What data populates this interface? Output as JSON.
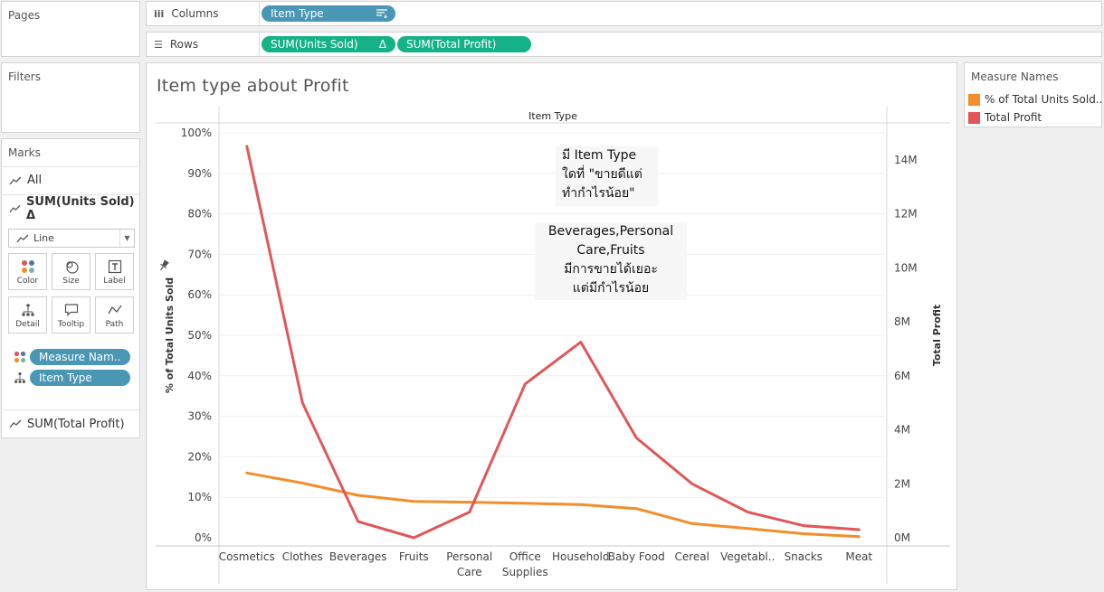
{
  "sidebar": {
    "pages_title": "Pages",
    "filters_title": "Filters",
    "marks_title": "Marks",
    "marks_all": "All",
    "marks_units": "SUM(Units Sold) Δ",
    "mark_type": "Line",
    "mark_buttons": [
      "Color",
      "Size",
      "Label",
      "Detail",
      "Tooltip",
      "Path"
    ],
    "pill_measure": "Measure Nam..",
    "pill_item": "Item Type",
    "marks_profit": "SUM(Total Profit)"
  },
  "shelves": {
    "columns_label": "Columns",
    "columns_pill": "Item Type",
    "rows_label": "Rows",
    "rows_pill1": "SUM(Units Sold)",
    "rows_pill1_delta": "Δ",
    "rows_pill2": "SUM(Total Profit)"
  },
  "legend": {
    "title": "Measure Names",
    "items": [
      {
        "label": "% of Total Units Sold..",
        "color": "#f28e2b"
      },
      {
        "label": "Total Profit",
        "color": "#e15759"
      }
    ]
  },
  "annotations": {
    "a1": [
      "มี Item Type",
      "ใดที่ \"ขายดีแต่",
      "ทำกำไรน้อย\""
    ],
    "a2": [
      "Beverages,Personal",
      "Care,Fruits",
      "มีการขายได้เยอะ",
      "แต่มีกำไรน้อย"
    ]
  },
  "chart_data": {
    "type": "line",
    "title": "Item type about Profit",
    "header": "Item Type",
    "categories": [
      "Cosmetics",
      "Clothes",
      "Beverages",
      "Fruits",
      "Personal Care",
      "Office Supplies",
      "Household",
      "Baby Food",
      "Cereal",
      "Vegetabl..",
      "Snacks",
      "Meat"
    ],
    "category_labels": [
      [
        "Cosmetics"
      ],
      [
        "Clothes"
      ],
      [
        "Beverages"
      ],
      [
        "Fruits"
      ],
      [
        "Personal",
        "Care"
      ],
      [
        "Office",
        "Supplies"
      ],
      [
        "Household"
      ],
      [
        "Baby Food"
      ],
      [
        "Cereal"
      ],
      [
        "Vegetabl.."
      ],
      [
        "Snacks"
      ],
      [
        "Meat"
      ]
    ],
    "y_left": {
      "label": "% of Total Units Sold",
      "range": [
        0,
        100
      ],
      "ticks": [
        "0%",
        "10%",
        "20%",
        "30%",
        "40%",
        "50%",
        "60%",
        "70%",
        "80%",
        "90%",
        "100%"
      ]
    },
    "y_right": {
      "label": "Total Profit",
      "range": [
        0,
        15000000
      ],
      "ticks": [
        "0M",
        "2M",
        "4M",
        "6M",
        "8M",
        "10M",
        "12M",
        "14M"
      ]
    },
    "series": [
      {
        "name": "% of Total Units Sold",
        "axis": "left",
        "color": "#f28e2b",
        "values": [
          16,
          13.5,
          10.5,
          9,
          8.8,
          8.5,
          8.2,
          7.2,
          3.5,
          2.3,
          1,
          0.3
        ]
      },
      {
        "name": "Total Profit",
        "axis": "right",
        "color": "#e15759",
        "values": [
          14500000,
          5000000,
          600000,
          0,
          950000,
          5700000,
          7250000,
          3700000,
          2000000,
          950000,
          450000,
          300000
        ]
      }
    ]
  }
}
